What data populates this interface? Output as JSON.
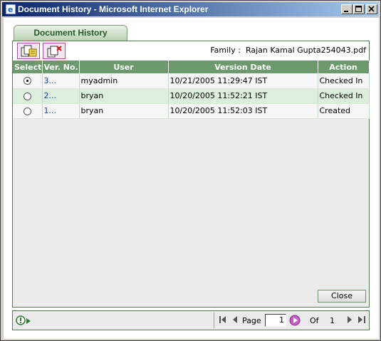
{
  "window": {
    "title": "Document History - Microsoft Internet Explorer"
  },
  "tab": {
    "label": "Document History"
  },
  "family": {
    "label": "Family :",
    "value": "Rajan Kamal Gupta254043.pdf"
  },
  "table": {
    "headers": [
      "Select",
      "Ver. No.",
      "User",
      "Version Date",
      "Action"
    ],
    "rows": [
      {
        "selected": true,
        "version": "3...",
        "user": "myadmin",
        "date": "10/21/2005 11:29:47 IST",
        "action": "Checked In"
      },
      {
        "selected": false,
        "version": "2...",
        "user": "bryan",
        "date": "10/20/2005 11:52:21 IST",
        "action": "Checked In"
      },
      {
        "selected": false,
        "version": "1...",
        "user": "bryan",
        "date": "10/20/2005 11:52:03 IST",
        "action": "Created"
      }
    ]
  },
  "close_label": "Close",
  "pager": {
    "page_label": "Page",
    "page_value": "1",
    "of_label": "Of",
    "total_pages": "1"
  },
  "icons": {
    "app": "ie-icon",
    "compare_versions": "copy-compare-icon",
    "delete_version": "copy-delete-icon",
    "status": "info-icon"
  },
  "colors": {
    "title_start": "#0a246a",
    "title_end": "#a6caf0",
    "header_green": "#6c9a6c",
    "row_highlight": "#dcefdc",
    "border_green": "#4f7d4f",
    "accent_purple": "#a050a0"
  }
}
